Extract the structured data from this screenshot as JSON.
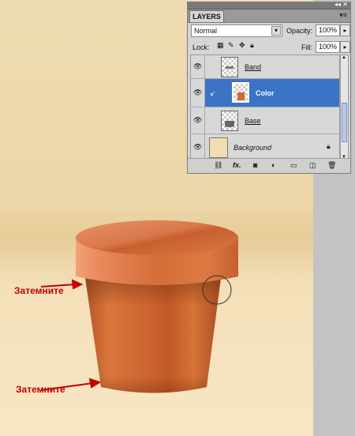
{
  "annotations": {
    "top_label": "Затемните",
    "bottom_label": "Затемните"
  },
  "layers_panel": {
    "tab_title": "LAYERS",
    "blend_mode": "Normal",
    "opacity_label": "Opacity:",
    "opacity_value": "100%",
    "lock_label": "Lock:",
    "fill_label": "Fill:",
    "fill_value": "100%",
    "layers": [
      {
        "name": "Band",
        "visible": true,
        "selected": false
      },
      {
        "name": "Color",
        "visible": true,
        "selected": true,
        "clipped": true
      },
      {
        "name": "Base",
        "visible": true,
        "selected": false
      },
      {
        "name": "Background",
        "visible": true,
        "selected": false,
        "locked": true
      }
    ],
    "footer_icons": [
      "link-icon",
      "fx-icon",
      "mask-icon",
      "adjustment-icon",
      "folder-icon",
      "new-layer-icon",
      "trash-icon"
    ]
  },
  "colors": {
    "pot_orange": "#d9773d",
    "selection_blue": "#3b73c6",
    "annotation_red": "#c40000"
  }
}
